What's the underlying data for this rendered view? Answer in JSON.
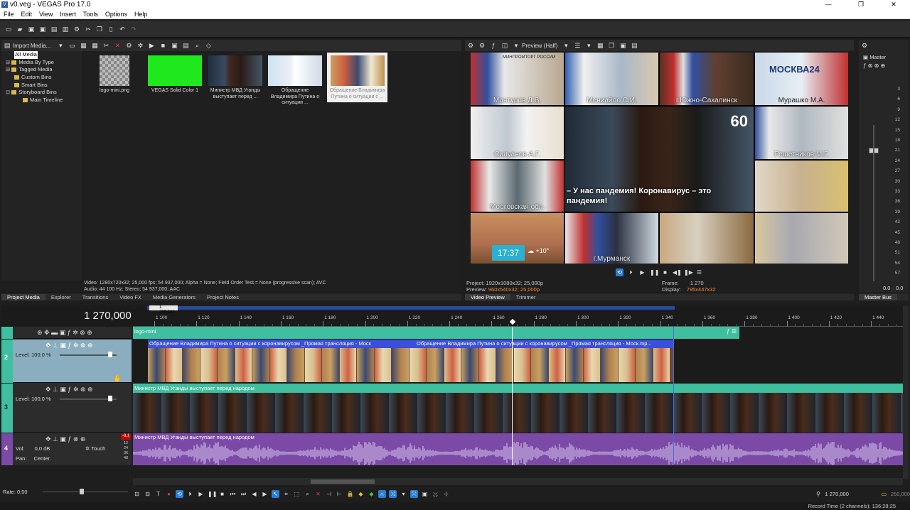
{
  "window": {
    "title": "v0.veg - VEGAS Pro 17.0",
    "controls": [
      "—",
      "❐",
      "✕"
    ]
  },
  "menu": [
    "File",
    "Edit",
    "View",
    "Insert",
    "Tools",
    "Options",
    "Help"
  ],
  "project_media": {
    "import_label": "Import Media...",
    "tree": [
      {
        "label": "All Media",
        "selected": true
      },
      {
        "label": "Media By Type"
      },
      {
        "label": "Tagged Media"
      },
      {
        "label": "Custom Bins"
      },
      {
        "label": "Smart Bins"
      },
      {
        "label": "Storyboard Bins"
      },
      {
        "label": "Main Timeline"
      }
    ],
    "items": [
      {
        "caption": "logo-mini.png"
      },
      {
        "caption": "VEGAS Solid Color 1"
      },
      {
        "caption": "Министр МВД Уганды выступает перед ..."
      },
      {
        "caption": "Обращение Владимира Путина о ситуации ..."
      },
      {
        "caption": "Обращение Владимира Путина о ситуации с ..."
      }
    ],
    "info_line1": "Video: 1280x720x32; 25,000 fps; 54 937,000; Alpha = None; Field Order Test = None (progressive scan); AVC",
    "info_line2": "Audio: 44 100 Hz; Stereo; 54 937,000; AAC",
    "tabs": [
      "Project Media",
      "Explorer",
      "Transitions",
      "Video FX",
      "Media Generators",
      "Project Notes"
    ]
  },
  "preview": {
    "mode_label": "Preview (Half)",
    "names": [
      "Мантуров Д.В.",
      "Мениайло С.И.",
      "г.Южно-Сахалинск",
      "Мурашко М.А.",
      "Силуанов А.Г.",
      "Решетников М.Г.",
      "Московская обл.",
      "г.Мурманск"
    ],
    "subtitle": "– У нас пандемия! Коронавирус – это пандемия!",
    "channel_logo": "МИНПРОМТОРГ РОССИИ",
    "moscow_logo": "МОСКВА24",
    "time_tile": "17:37",
    "temp": "+10°",
    "project_label": "Project:",
    "project_value": "1920x1080x32; 25,000p",
    "preview_label": "Preview:",
    "preview_value": "960x540x32; 25,000p",
    "frame_label": "Frame:",
    "frame_value": "1 270",
    "display_label": "Display:",
    "display_value": "795x447x32",
    "tabs": [
      "Video Preview",
      "Trimmer"
    ]
  },
  "master": {
    "label": "Master",
    "scale": [
      "3",
      "6",
      "9",
      "12",
      "15",
      "18",
      "21",
      "24",
      "27",
      "30",
      "33",
      "36",
      "39",
      "42",
      "45",
      "48",
      "51",
      "54",
      "57"
    ],
    "left_val": "0.0",
    "right_val": "0.0",
    "tab": "Master Bus"
  },
  "timeline": {
    "position": "1 270,000",
    "loop_marker": "1 255,000",
    "ruler": [
      "1 100",
      "1 120",
      "1 140",
      "1 160",
      "1 180",
      "1 200",
      "1 220",
      "1 240",
      "1 260",
      "1 280",
      "1 300",
      "1 320",
      "1 340",
      "1 360",
      "1 380",
      "1 400",
      "1 420",
      "1 440"
    ],
    "tracks": [
      {
        "num": "1",
        "event": "logo-mini"
      },
      {
        "num": "2",
        "level": "Level: 100,0 %",
        "events": [
          "Обращение Владимира Путина о ситуации с коронавирусом _Прямая трансляция - Моск",
          "Обращение Владимира Путина о ситуации с коронавирусом _Прямая трансляция - Моск.mp..."
        ]
      },
      {
        "num": "3",
        "level": "Level: 100,0 %",
        "event": "Министр МВД Уганды выступает перед народом"
      },
      {
        "num": "4",
        "vol_label": "Vol:",
        "vol_value": "0,0 dB",
        "pan_label": "Pan:",
        "pan_value": "Center",
        "touch": "Touch",
        "event": "Министр МВД Уганды выступает перед народом",
        "meter": [
          "12",
          "24",
          "36",
          "48"
        ],
        "peak": "-8.1"
      }
    ],
    "rate": "Rate: 0,00",
    "cursor_time": "1 270,000",
    "end_time": "250,000",
    "record_time": "Record Time (2 channels): 136:28:25"
  },
  "colors": {
    "accent": "#2a7fd4",
    "track_teal": "#3fbf9f",
    "event_blue": "#3b4fd8",
    "audio_purple": "#7b4aa6"
  }
}
